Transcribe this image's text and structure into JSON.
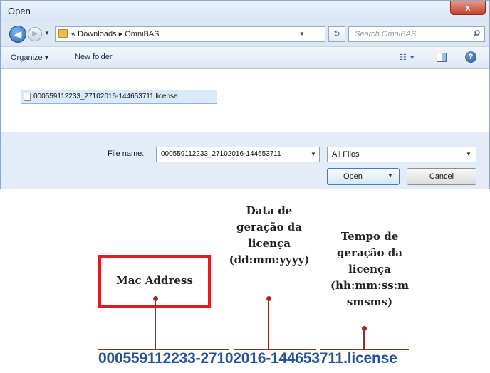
{
  "dialog": {
    "title": "Open",
    "close_glyph": "x",
    "nav": {
      "back_glyph": "◀",
      "forward_glyph": "▶",
      "breadcrumbs": "« Downloads ▸ OmniBAS",
      "search_placeholder": "Search OmniBAS"
    },
    "toolbar": {
      "organize_label": "Organize ▾",
      "new_folder_label": "New folder",
      "help_glyph": "?"
    },
    "files": [
      {
        "name": "000559112233_27102016-144653711.license",
        "selected": true
      }
    ],
    "bottom": {
      "file_name_label": "File name:",
      "file_name_value": "000559112233_27102016-144653711",
      "file_type": "All Files",
      "open_label": "Open",
      "cancel_label": "Cancel"
    }
  },
  "annotation": {
    "mac_label": "Mac Address",
    "date_lines": [
      "Data de",
      "geração da",
      "licença",
      "(dd:mm:yyyy)"
    ],
    "time_lines": [
      "Tempo de",
      "geração da",
      "licença",
      "(hh:mm:ss:m",
      "smsms)"
    ],
    "license_string": "000559112233-27102016-144653711.license",
    "colors": {
      "box_red": "#e01b24",
      "connector": "#9a2b2b",
      "license_blue": "#1f5394"
    }
  }
}
